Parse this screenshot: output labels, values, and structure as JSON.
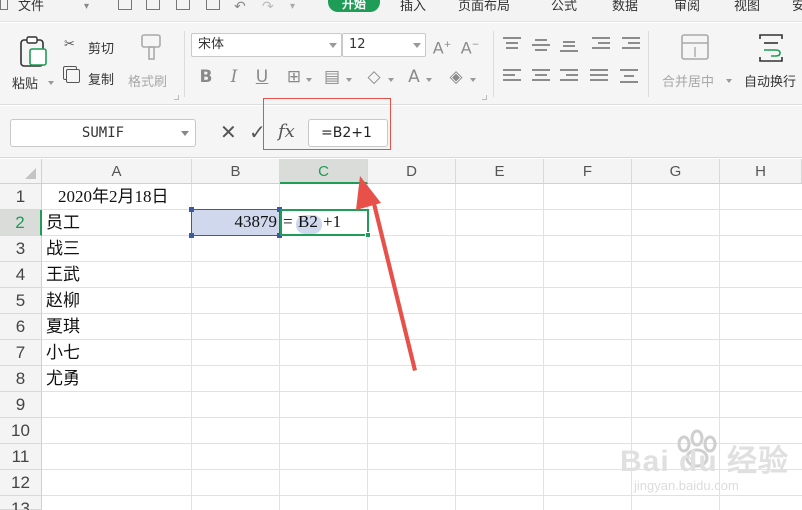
{
  "menu": {
    "file": "文件",
    "home": "开始",
    "insert": "插入",
    "page_layout": "页面布局",
    "formulas": "公式",
    "data": "数据",
    "review": "审阅",
    "view": "视图",
    "security": "安"
  },
  "ribbon": {
    "paste": "粘贴",
    "cut": "剪切",
    "copy": "复制",
    "format_painter": "格式刷",
    "font_name": "宋体",
    "font_size": "12",
    "merge_center": "合并居中",
    "wrap_text": "自动换行"
  },
  "formula_bar": {
    "name_box": "SUMIF",
    "fx_label": "fx",
    "formula": "=B2+1"
  },
  "grid": {
    "columns": [
      "A",
      "B",
      "C",
      "D",
      "E",
      "F",
      "G",
      "H"
    ],
    "selected_column": "C",
    "rows": [
      "1",
      "2",
      "3",
      "4",
      "5",
      "6",
      "7",
      "8",
      "9",
      "10",
      "11",
      "12",
      "13"
    ],
    "selected_row": "2"
  },
  "cells": {
    "a1": "2020年2月18日",
    "a2": "员工",
    "a3": "战三",
    "a4": "王武",
    "a5": "赵柳",
    "a6": "夏琪",
    "a7": "小七",
    "a8": "尤勇",
    "b2": "43879",
    "c2_eq": "=",
    "c2_ref": "B2",
    "c2_rest": "+1"
  },
  "watermark": {
    "brand": "Bai du 经验",
    "url": "jingyan.baidu.com"
  },
  "colors": {
    "accent": "#1f9c55",
    "selection_blue": "#3a5aa8",
    "annotation_red": "#e8504a"
  }
}
